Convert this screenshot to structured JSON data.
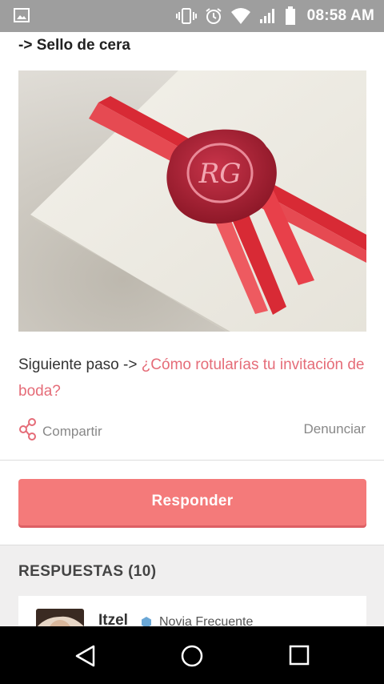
{
  "status_bar": {
    "time": "08:58 AM",
    "icons": [
      "gallery-icon",
      "vibrate-icon",
      "alarm-icon",
      "wifi-icon",
      "signal-icon",
      "battery-icon"
    ]
  },
  "post": {
    "section_title": "-> Sello de cera",
    "image_alt": "wax-seal-invitation-photo",
    "next_step_prefix": "Siguiente paso -> ",
    "next_step_link": "¿Cómo rotularías tu invitación de boda?",
    "share_label": "Compartir",
    "report_label": "Denunciar"
  },
  "reply_button": {
    "label": "Responder"
  },
  "answers": {
    "title": "RESPUESTAS (10)",
    "items": [
      {
        "author": "Itzel",
        "role": "Novia Frecuente"
      }
    ]
  },
  "nav_bar": {
    "buttons": [
      "back-icon",
      "home-icon",
      "recents-icon"
    ]
  },
  "colors": {
    "accent": "#f47a7a",
    "link": "#e56c78",
    "status_bar": "#9e9e9e",
    "answers_bg": "#f0efef"
  }
}
